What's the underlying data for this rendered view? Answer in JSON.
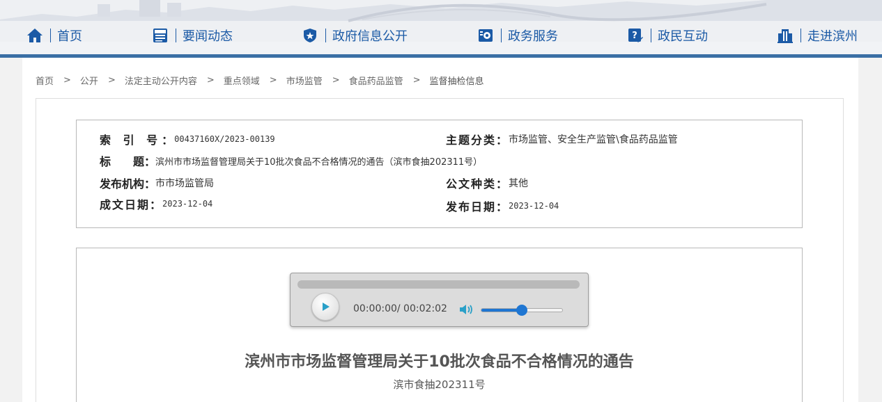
{
  "nav": [
    {
      "label": "首页",
      "icon": "home-icon"
    },
    {
      "label": "要闻动态",
      "icon": "news-icon"
    },
    {
      "label": "政府信息公开",
      "icon": "badge-icon"
    },
    {
      "label": "政务服务",
      "icon": "service-icon"
    },
    {
      "label": "政民互动",
      "icon": "interaction-icon"
    },
    {
      "label": "走进滨州",
      "icon": "building-icon"
    }
  ],
  "breadcrumb": {
    "separator": ">",
    "items": [
      "首页",
      "公开",
      "法定主动公开内容",
      "重点领域",
      "市场监管",
      "食品药品监管",
      "监督抽检信息"
    ]
  },
  "meta": {
    "index_label": "索 引 号：",
    "index_value": "00437160X/2023-00139",
    "topic_label": "主题分类：",
    "topic_value": "市场监管、安全生产监管\\食品药品监管",
    "title_label": "标　　题：",
    "title_value": "滨州市市场监督管理局关于10批次食品不合格情况的通告（滨市食抽202311号）",
    "org_label": "发布机构：",
    "org_value": "市市场监管局",
    "doctype_label": "公文种类：",
    "doctype_value": "其他",
    "created_label": "成文日期：",
    "created_value": "2023-12-04",
    "published_label": "发布日期：",
    "published_value": "2023-12-04"
  },
  "player": {
    "time_display": "00:00:00/ 00:02:02",
    "progress": 0,
    "volume": 0.5
  },
  "article": {
    "title": "滨州市市场监督管理局关于10批次食品不合格情况的通告",
    "doc_number": "滨市食抽202311号"
  },
  "colors": {
    "nav_blue": "#1b5aa6",
    "header_line": "#3a6fa5",
    "accent": "#1f76d2"
  }
}
